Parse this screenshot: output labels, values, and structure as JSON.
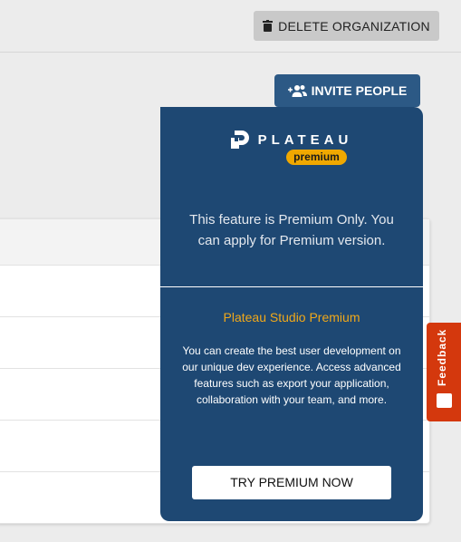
{
  "header": {
    "delete_label": "DELETE ORGANIZATION"
  },
  "toolbar": {
    "invite_label": "INVITE PEOPLE"
  },
  "premium_panel": {
    "logo_text": "PLATEAU",
    "badge": "premium",
    "message": "This feature is Premium Only. You can apply for Premium version.",
    "title": "Plateau Studio Premium",
    "description": "You can create the best user development on our unique dev experience. Access advanced features such as export your application, collaboration with your team, and more.",
    "cta": "TRY PREMIUM NOW",
    "colors": {
      "panel": "#1e4873",
      "accent": "#f0a800"
    }
  },
  "feedback": {
    "label": "Feedback",
    "color": "#d4380d"
  }
}
